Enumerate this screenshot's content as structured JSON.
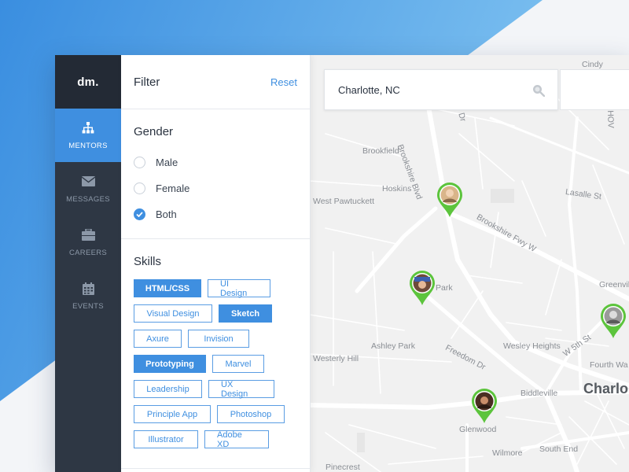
{
  "brand": {
    "logo": "dm."
  },
  "colors": {
    "accent": "#3f8fe0",
    "nav_bg": "#2e3744",
    "pin_green": "#5cc43c"
  },
  "nav": {
    "items": [
      {
        "label": "MENTORS",
        "icon": "sitemap-icon",
        "active": true
      },
      {
        "label": "MESSAGES",
        "icon": "envelope-icon",
        "active": false
      },
      {
        "label": "CAREERS",
        "icon": "briefcase-icon",
        "active": false
      },
      {
        "label": "EVENTS",
        "icon": "calendar-icon",
        "active": false
      }
    ]
  },
  "filter": {
    "title": "Filter",
    "reset_label": "Reset",
    "gender": {
      "title": "Gender",
      "options": [
        {
          "label": "Male",
          "checked": false
        },
        {
          "label": "Female",
          "checked": false
        },
        {
          "label": "Both",
          "checked": true
        }
      ]
    },
    "skills": {
      "title": "Skills",
      "chips": [
        {
          "label": "HTML/CSS",
          "selected": true
        },
        {
          "label": "UI Design",
          "selected": false
        },
        {
          "label": "Visual Design",
          "selected": false
        },
        {
          "label": "Sketch",
          "selected": true
        },
        {
          "label": "Axure",
          "selected": false
        },
        {
          "label": "Invision",
          "selected": false
        },
        {
          "label": "Prototyping",
          "selected": true
        },
        {
          "label": "Marvel",
          "selected": false
        },
        {
          "label": "Leadership",
          "selected": false
        },
        {
          "label": "UX Design",
          "selected": false
        },
        {
          "label": "Principle App",
          "selected": false
        },
        {
          "label": "Photoshop",
          "selected": false
        },
        {
          "label": "Illustrator",
          "selected": false
        },
        {
          "label": "Adobe XD",
          "selected": false
        }
      ]
    }
  },
  "map": {
    "search_value": "Charlotte, NC",
    "labels": {
      "cindy": "Cindy",
      "brookshire_blvd": "Brookshire Blvd",
      "dr": "Dr",
      "hov": "HOV",
      "brookfield": "Brookfield",
      "west_pawtuckett": "West Pawtuckett",
      "hoskins": "Hoskins",
      "lasalle": "Lasalle St",
      "brookshire_fwy": "Brookshire Fwy W",
      "park": "Park",
      "greenville": "Greenvil",
      "ashley_park": "Ashley Park",
      "freedom": "Freedom Dr",
      "wesley_heights": "Wesley Heights",
      "w5th": "W 5th St",
      "westerly_hill": "Westerly Hill",
      "fourth_ward": "Fourth Wa",
      "biddleville": "Biddleville",
      "charlotte": "Charlo",
      "glenwood": "Glenwood",
      "wilmore": "Wilmore",
      "south_end": "South End",
      "pinecrest": "Pinecrest"
    }
  }
}
